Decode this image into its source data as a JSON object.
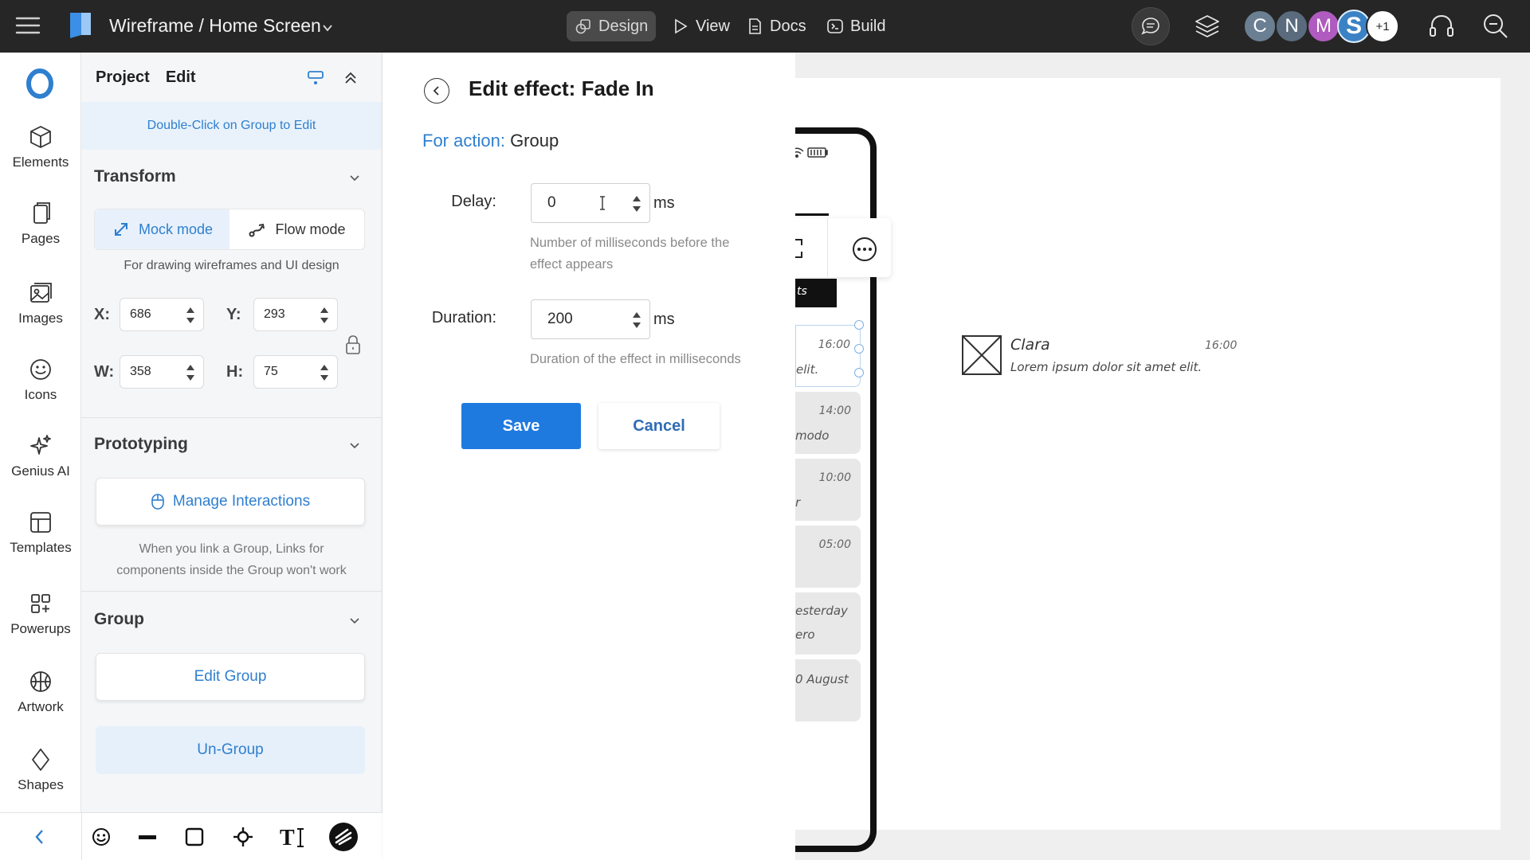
{
  "topbar": {
    "title": "Wireframe / Home Screen",
    "nav": [
      {
        "label": "Design",
        "icon": "design-icon",
        "active": true
      },
      {
        "label": "View",
        "icon": "play-icon"
      },
      {
        "label": "Docs",
        "icon": "document-icon"
      },
      {
        "label": "Build",
        "icon": "code-icon"
      }
    ],
    "avatars": [
      {
        "initial": "C",
        "color": "#6b7f93"
      },
      {
        "initial": "N",
        "color": "#5a6b7d"
      },
      {
        "initial": "M",
        "color": "#b05bbf"
      },
      {
        "initial": "S",
        "color": "#3b82c4"
      }
    ],
    "more_avatars": "+1"
  },
  "rail": {
    "items": [
      {
        "label": "Elements",
        "icon": "cube-icon"
      },
      {
        "label": "Pages",
        "icon": "pages-icon"
      },
      {
        "label": "Images",
        "icon": "image-icon"
      },
      {
        "label": "Icons",
        "icon": "smiley-icon"
      },
      {
        "label": "Genius AI",
        "icon": "sparkle-icon"
      },
      {
        "label": "Templates",
        "icon": "template-icon"
      },
      {
        "label": "Powerups",
        "icon": "grid-plus-icon"
      },
      {
        "label": "Artwork",
        "icon": "basketball-icon"
      },
      {
        "label": "Shapes",
        "icon": "diamond-icon"
      }
    ]
  },
  "props": {
    "tab_project": "Project",
    "tab_edit": "Edit",
    "hint": "Double-Click on Group to Edit",
    "transform": {
      "title": "Transform",
      "mock_mode": "Mock mode",
      "flow_mode": "Flow mode",
      "note": "For drawing wireframes and UI design",
      "x_label": "X:",
      "x_value": "686",
      "y_label": "Y:",
      "y_value": "293",
      "w_label": "W:",
      "w_value": "358",
      "h_label": "H:",
      "h_value": "75"
    },
    "prototyping": {
      "title": "Prototyping",
      "manage": "Manage Interactions",
      "note_line1": "When you link a Group, Links for",
      "note_line2": "components inside the Group won't work"
    },
    "group": {
      "title": "Group",
      "edit": "Edit Group",
      "ungroup": "Un-Group"
    }
  },
  "effect": {
    "title": "Edit effect: Fade In",
    "for_action_label": "For action:",
    "for_action_value": "Group",
    "delay_label": "Delay:",
    "delay_value": "0",
    "delay_unit": "ms",
    "delay_hint_line1": "Number of milliseconds before the",
    "delay_hint_line2": "effect appears",
    "duration_label": "Duration:",
    "duration_value": "200",
    "duration_unit": "ms",
    "duration_hint": "Duration of the effect in milliseconds",
    "save": "Save",
    "cancel": "Cancel"
  },
  "canvas": {
    "dark_tab_text": "ts",
    "cards": [
      {
        "time": "16:00",
        "text": "elit.",
        "selected": true
      },
      {
        "time": "14:00",
        "text": "modo"
      },
      {
        "time": "10:00",
        "text": "r"
      },
      {
        "time": "05:00",
        "text": ""
      },
      {
        "time": "",
        "text": "esterday",
        "text2": "ero"
      },
      {
        "time": "",
        "text": "0 August"
      }
    ],
    "clara": {
      "name": "Clara",
      "time": "16:00",
      "body": "Lorem ipsum dolor sit amet elit."
    }
  },
  "colors": {
    "accent": "#2f7fcf",
    "primary_button": "#1f7ae0",
    "topbar": "#262626"
  }
}
